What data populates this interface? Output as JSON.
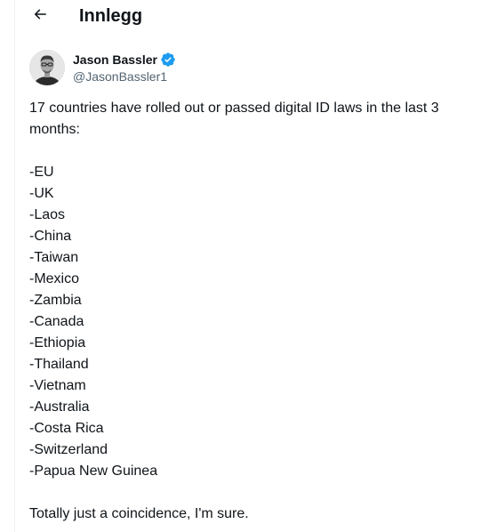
{
  "header": {
    "title": "Innlegg",
    "back_icon": "arrow-left-icon"
  },
  "author": {
    "display_name": "Jason Bassler",
    "handle": "@JasonBassler1",
    "verified": true,
    "verified_color": "#1d9bf0",
    "avatar_icon": "profile-photo"
  },
  "tweet": {
    "intro": "17 countries have rolled out or passed digital ID laws in the last 3 months:",
    "countries": [
      "-EU",
      "-UK",
      "-Laos",
      "-China",
      "-Taiwan",
      "-Mexico",
      "-Zambia",
      "-Canada",
      "-Ethiopia",
      "-Thailand",
      "-Vietnam",
      "-Australia",
      "-Costa Rica",
      "-Switzerland",
      "-Papua New Guinea"
    ],
    "closing": "Totally just a coincidence, I'm sure."
  }
}
